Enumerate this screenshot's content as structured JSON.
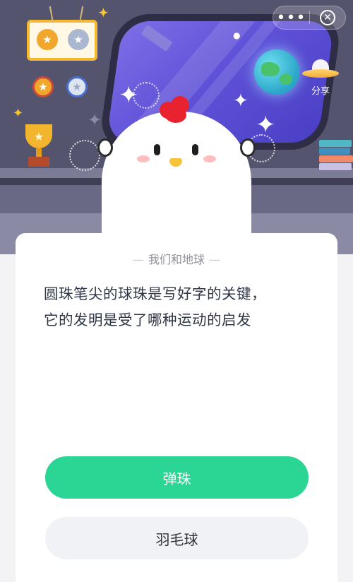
{
  "topbar": {
    "more_label": "•••",
    "close_label": "✕"
  },
  "share": {
    "label": "分享"
  },
  "quiz": {
    "category": "我们和地球",
    "question_line1": "圆珠笔尖的球珠是写好字的关键，",
    "question_line2": "它的发明是受了哪种运动的启发",
    "options": [
      {
        "label": "弹珠",
        "state": "selected-correct"
      },
      {
        "label": "羽毛球",
        "state": "default"
      }
    ]
  },
  "colors": {
    "accent_green": "#2bd694",
    "scene_bg": "#55546e",
    "option_plain_bg": "#f1f2f5"
  },
  "icons": {
    "more": "more-dots-icon",
    "close": "close-circle-icon",
    "share": "ufo-share-icon",
    "planet": "earth-icon",
    "trophy": "trophy-icon",
    "mascot": "chicken-mascot"
  }
}
